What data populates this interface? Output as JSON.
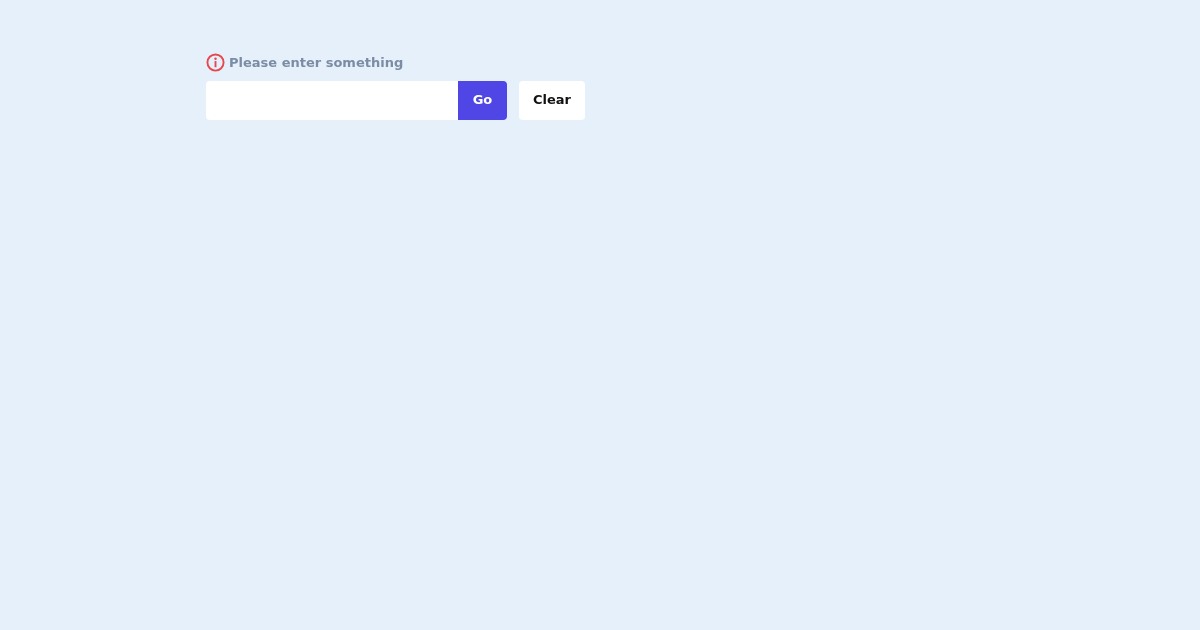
{
  "error_message": {
    "text": "Please enter something"
  },
  "buttons": [
    {
      "label": "Go",
      "kind": "primary"
    },
    {
      "label": "Clear",
      "kind": "secondary"
    }
  ]
}
